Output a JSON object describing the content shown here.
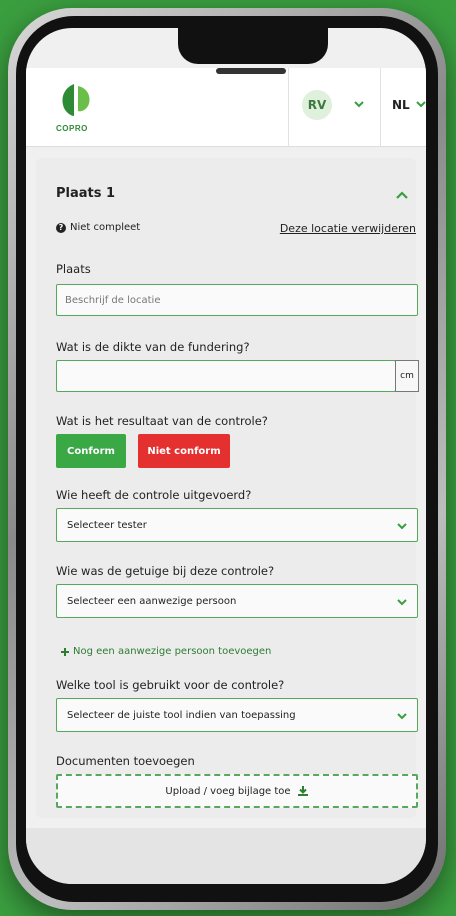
{
  "header": {
    "logo_text": "COPRO",
    "avatar_initials": "RV",
    "language": "NL"
  },
  "card": {
    "title": "Plaats 1",
    "status_text": "Niet compleet",
    "remove_link": "Deze locatie verwijderen",
    "plaats_label": "Plaats",
    "plaats_placeholder": "Beschrijf de locatie",
    "thickness_label": "Wat is de dikte van de fundering?",
    "thickness_value": "",
    "thickness_unit": "cm",
    "result_label": "Wat is het resultaat van de controle?",
    "conform_button": "Conform",
    "not_conform_button": "Niet conform",
    "tester_label": "Wie heeft de controle uitgevoerd?",
    "tester_selected": "Selecteer tester",
    "witness_label": "Wie was de getuige bij deze controle?",
    "witness_selected": "Selecteer een aanwezige persoon",
    "add_person_link": "Nog een aanwezige persoon toevoegen",
    "tool_label": "Welke tool is gebruikt voor de controle?",
    "tool_selected": "Selecteer de juiste tool indien van toepassing",
    "documents_label": "Documenten toevoegen",
    "upload_label": "Upload / voeg bijlage toe"
  },
  "colors": {
    "brand_green": "#3a9e3f",
    "border_green": "#58a75e",
    "conform_green": "#39a845",
    "not_conform_red": "#e53030"
  },
  "icons": {
    "status": "question-circle-icon",
    "dropdown": "chevron-down-icon",
    "add": "plus-icon",
    "upload": "download-icon"
  }
}
